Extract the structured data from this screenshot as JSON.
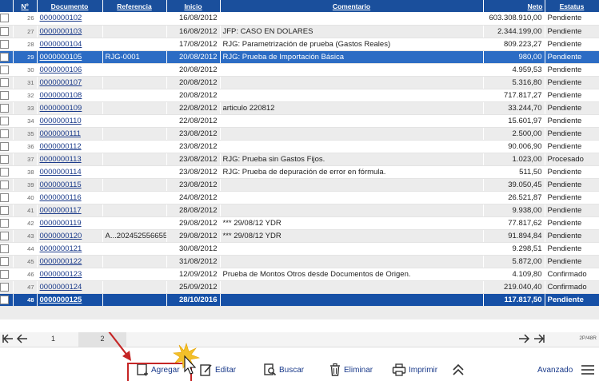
{
  "columns": {
    "num": "Nº",
    "documento": "Documento",
    "referencia": "Referencia",
    "inicio": "Inicio",
    "comentario": "Comentario",
    "neto": "Neto",
    "estatus": "Estatus"
  },
  "rows": [
    {
      "num": "26",
      "documento": "0000000102",
      "referencia": "",
      "inicio": "16/08/2012",
      "comentario": "",
      "neto": "603.308.910,00",
      "estatus": "Pendiente"
    },
    {
      "num": "27",
      "documento": "0000000103",
      "referencia": "",
      "inicio": "16/08/2012",
      "comentario": "JFP: CASO EN DOLARES",
      "neto": "2.344.199,00",
      "estatus": "Pendiente"
    },
    {
      "num": "28",
      "documento": "0000000104",
      "referencia": "",
      "inicio": "17/08/2012",
      "comentario": "RJG: Parametrización de prueba (Gastos Reales)",
      "neto": "809.223,27",
      "estatus": "Pendiente"
    },
    {
      "num": "29",
      "documento": "0000000105",
      "referencia": "RJG-0001",
      "inicio": "20/08/2012",
      "comentario": "RJG: Prueba de Importación Básica",
      "neto": "980,00",
      "estatus": "Pendiente"
    },
    {
      "num": "30",
      "documento": "0000000106",
      "referencia": "",
      "inicio": "20/08/2012",
      "comentario": "",
      "neto": "4.959,53",
      "estatus": "Pendiente"
    },
    {
      "num": "31",
      "documento": "0000000107",
      "referencia": "",
      "inicio": "20/08/2012",
      "comentario": "",
      "neto": "5.316,80",
      "estatus": "Pendiente"
    },
    {
      "num": "32",
      "documento": "0000000108",
      "referencia": "",
      "inicio": "20/08/2012",
      "comentario": "",
      "neto": "717.817,27",
      "estatus": "Pendiente"
    },
    {
      "num": "33",
      "documento": "0000000109",
      "referencia": "",
      "inicio": "22/08/2012",
      "comentario": "articulo 220812",
      "neto": "33.244,70",
      "estatus": "Pendiente"
    },
    {
      "num": "34",
      "documento": "0000000110",
      "referencia": "",
      "inicio": "22/08/2012",
      "comentario": "",
      "neto": "15.601,97",
      "estatus": "Pendiente"
    },
    {
      "num": "35",
      "documento": "0000000111",
      "referencia": "",
      "inicio": "23/08/2012",
      "comentario": "",
      "neto": "2.500,00",
      "estatus": "Pendiente"
    },
    {
      "num": "36",
      "documento": "0000000112",
      "referencia": "",
      "inicio": "23/08/2012",
      "comentario": "",
      "neto": "90.006,90",
      "estatus": "Pendiente"
    },
    {
      "num": "37",
      "documento": "0000000113",
      "referencia": "",
      "inicio": "23/08/2012",
      "comentario": "RJG: Prueba sin Gastos Fijos.",
      "neto": "1.023,00",
      "estatus": "Procesado"
    },
    {
      "num": "38",
      "documento": "0000000114",
      "referencia": "",
      "inicio": "23/08/2012",
      "comentario": "RJG: Prueba de depuración de error en fórmula.",
      "neto": "511,50",
      "estatus": "Pendiente"
    },
    {
      "num": "39",
      "documento": "0000000115",
      "referencia": "",
      "inicio": "23/08/2012",
      "comentario": "",
      "neto": "39.050,45",
      "estatus": "Pendiente"
    },
    {
      "num": "40",
      "documento": "0000000116",
      "referencia": "",
      "inicio": "24/08/2012",
      "comentario": "",
      "neto": "26.521,87",
      "estatus": "Pendiente"
    },
    {
      "num": "41",
      "documento": "0000000117",
      "referencia": "",
      "inicio": "28/08/2012",
      "comentario": "",
      "neto": "9.938,00",
      "estatus": "Pendiente"
    },
    {
      "num": "42",
      "documento": "0000000119",
      "referencia": "",
      "inicio": "29/08/2012",
      "comentario": "*** 29/08/12 YDR",
      "neto": "77.817,62",
      "estatus": "Pendiente"
    },
    {
      "num": "43",
      "documento": "0000000120",
      "referencia": "A...202452556655",
      "inicio": "29/08/2012",
      "comentario": "*** 29/08/12 YDR",
      "neto": "91.894,84",
      "estatus": "Pendiente"
    },
    {
      "num": "44",
      "documento": "0000000121",
      "referencia": "",
      "inicio": "30/08/2012",
      "comentario": "",
      "neto": "9.298,51",
      "estatus": "Pendiente"
    },
    {
      "num": "45",
      "documento": "0000000122",
      "referencia": "",
      "inicio": "31/08/2012",
      "comentario": "",
      "neto": "5.872,00",
      "estatus": "Pendiente"
    },
    {
      "num": "46",
      "documento": "0000000123",
      "referencia": "",
      "inicio": "12/09/2012",
      "comentario": "Prueba de Montos Otros desde Documentos de Origen.",
      "neto": "4.109,80",
      "estatus": "Confirmado"
    },
    {
      "num": "47",
      "documento": "0000000124",
      "referencia": "",
      "inicio": "25/09/2012",
      "comentario": "",
      "neto": "219.040,40",
      "estatus": "Confirmado"
    },
    {
      "num": "48",
      "documento": "0000000125",
      "referencia": "",
      "inicio": "28/10/2016",
      "comentario": "",
      "neto": "117.817,50",
      "estatus": "Pendiente"
    }
  ],
  "pager": {
    "page1": "1",
    "page2": "2",
    "count": "2P/48R"
  },
  "toolbar": {
    "agregar": "Agregar",
    "editar": "Editar",
    "buscar": "Buscar",
    "eliminar": "Eliminar",
    "imprimir": "Imprimir",
    "avanzado": "Avanzado"
  },
  "colors": {
    "header": "#1a4f9c",
    "selected": "#2c6cc4",
    "selected_dark": "#1650a6",
    "highlight": "#c52525"
  }
}
